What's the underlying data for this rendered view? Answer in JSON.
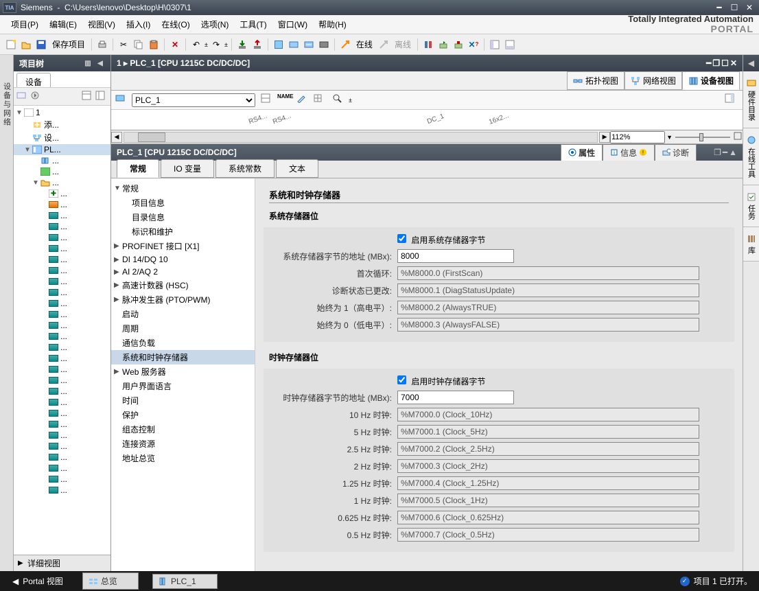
{
  "window": {
    "app": "Siemens",
    "path": "C:\\Users\\lenovo\\Desktop\\H\\0307\\1",
    "logo": "TIA"
  },
  "menu": {
    "items": [
      {
        "label": "项目",
        "key": "(P)"
      },
      {
        "label": "编辑",
        "key": "(E)"
      },
      {
        "label": "视图",
        "key": "(V)"
      },
      {
        "label": "插入",
        "key": "(I)"
      },
      {
        "label": "在线",
        "key": "(O)"
      },
      {
        "label": "选项",
        "key": "(N)"
      },
      {
        "label": "工具",
        "key": "(T)"
      },
      {
        "label": "窗口",
        "key": "(W)"
      },
      {
        "label": "帮助",
        "key": "(H)"
      }
    ],
    "brand1": "Totally Integrated Automation",
    "brand2": "PORTAL"
  },
  "toolbar": {
    "save_label": "保存项目",
    "online_label": "在线",
    "offline_label": "离线"
  },
  "project_tree": {
    "title": "项目树",
    "device_tab": "设备",
    "root": "1",
    "items": [
      {
        "label": "添...",
        "icon": "add"
      },
      {
        "label": "设...",
        "icon": "device"
      },
      {
        "label": "PL...",
        "icon": "plc"
      }
    ],
    "detail_view": "详细视图"
  },
  "left_tab": {
    "label": "设备与网络"
  },
  "editor": {
    "breadcrumb": "1  ▸  PLC_1 [CPU 1215C DC/DC/DC]",
    "view_tabs": {
      "topology": "拓扑视图",
      "network": "网络视图",
      "device": "设备视图"
    },
    "device_select": "PLC_1",
    "canvas_labels": [
      "RS4...",
      "RS4...",
      "DC_1",
      "16x2..."
    ],
    "zoom": "112%"
  },
  "inspector": {
    "device": "PLC_1 [CPU 1215C DC/DC/DC]",
    "tabs": {
      "properties": "属性",
      "info": "信息",
      "diagnostics": "诊断"
    },
    "prop_tabs": {
      "general": "常规",
      "io": "IO 变量",
      "constants": "系统常数",
      "texts": "文本"
    },
    "nav": [
      {
        "label": "常规",
        "expand": true,
        "level": 0
      },
      {
        "label": "项目信息",
        "level": 1
      },
      {
        "label": "目录信息",
        "level": 1
      },
      {
        "label": "标识和维护",
        "level": 1
      },
      {
        "label": "PROFINET 接口 [X1]",
        "expand": false,
        "level": 0
      },
      {
        "label": "DI 14/DQ 10",
        "expand": false,
        "level": 0
      },
      {
        "label": "AI 2/AQ 2",
        "expand": false,
        "level": 0
      },
      {
        "label": "高速计数器 (HSC)",
        "expand": false,
        "level": 0
      },
      {
        "label": "脉冲发生器 (PTO/PWM)",
        "expand": false,
        "level": 0
      },
      {
        "label": "启动",
        "level": 0
      },
      {
        "label": "周期",
        "level": 0
      },
      {
        "label": "通信负载",
        "level": 0
      },
      {
        "label": "系统和时钟存储器",
        "level": 0,
        "selected": true
      },
      {
        "label": "Web 服务器",
        "expand": false,
        "level": 0
      },
      {
        "label": "用户界面语言",
        "level": 0
      },
      {
        "label": "时间",
        "level": 0
      },
      {
        "label": "保护",
        "level": 0
      },
      {
        "label": "组态控制",
        "level": 0
      },
      {
        "label": "连接资源",
        "level": 0
      },
      {
        "label": "地址总览",
        "level": 0
      }
    ],
    "content": {
      "title": "系统和时钟存储器",
      "group1": {
        "title": "系统存储器位",
        "enable": "启用系统存储器字节",
        "addr_label": "系统存储器字节的地址 (MBx):",
        "addr_value": "8000",
        "rows": [
          {
            "label": "首次循环:",
            "value": "%M8000.0 (FirstScan)"
          },
          {
            "label": "诊断状态已更改:",
            "value": "%M8000.1 (DiagStatusUpdate)"
          },
          {
            "label": "始终为 1（高电平）:",
            "value": "%M8000.2 (AlwaysTRUE)"
          },
          {
            "label": "始终为 0（低电平）:",
            "value": "%M8000.3 (AlwaysFALSE)"
          }
        ]
      },
      "group2": {
        "title": "时钟存储器位",
        "enable": "启用时钟存储器字节",
        "addr_label": "时钟存储器字节的地址 (MBx):",
        "addr_value": "7000",
        "rows": [
          {
            "label": "10 Hz 时钟:",
            "value": "%M7000.0 (Clock_10Hz)"
          },
          {
            "label": "5 Hz 时钟:",
            "value": "%M7000.1 (Clock_5Hz)"
          },
          {
            "label": "2.5 Hz 时钟:",
            "value": "%M7000.2 (Clock_2.5Hz)"
          },
          {
            "label": "2 Hz 时钟:",
            "value": "%M7000.3 (Clock_2Hz)"
          },
          {
            "label": "1.25 Hz 时钟:",
            "value": "%M7000.4 (Clock_1.25Hz)"
          },
          {
            "label": "1 Hz 时钟:",
            "value": "%M7000.5 (Clock_1Hz)"
          },
          {
            "label": "0.625 Hz 时钟:",
            "value": "%M7000.6 (Clock_0.625Hz)"
          },
          {
            "label": "0.5 Hz 时钟:",
            "value": "%M7000.7 (Clock_0.5Hz)"
          }
        ]
      }
    }
  },
  "right_tabs": {
    "catalog": "硬件目录",
    "online": "在线工具",
    "tasks": "任务",
    "library": "库"
  },
  "statusbar": {
    "portal": "Portal 视图",
    "overview": "总览",
    "plc": "PLC_1",
    "status": "项目 1 已打开。"
  }
}
